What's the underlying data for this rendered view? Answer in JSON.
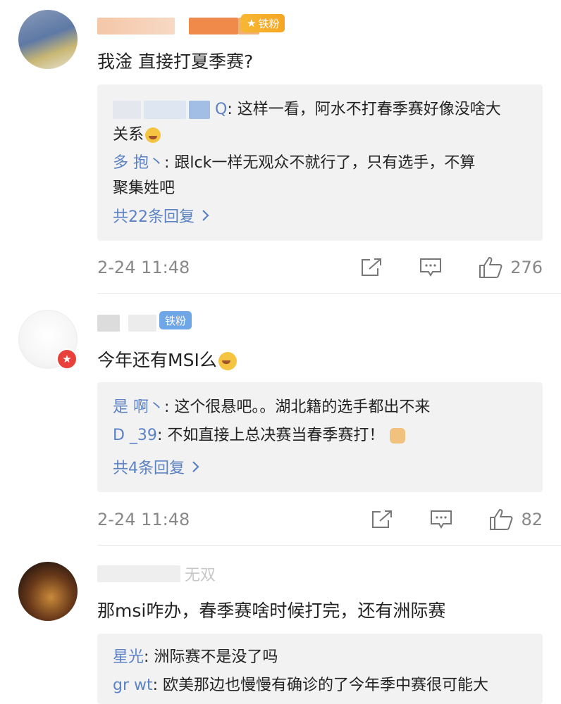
{
  "comments": [
    {
      "username": "",
      "badge": "铁粉",
      "badge_style": "gold",
      "text": "我淦 直接打夏季赛?",
      "replies": [
        {
          "name": "Q",
          "text": ": 这样一看，阿水不打春季赛好像没啥大",
          "text2": "关系"
        },
        {
          "name": "多 抱丶",
          "text": ": 跟lck一样无观众不就行了，只有选手，不算",
          "text2": "聚集姓吧"
        }
      ],
      "more_replies": "共22条回复",
      "timestamp": "2-24 11:48",
      "likes": "276"
    },
    {
      "username": "",
      "badge": "铁粉",
      "badge_style": "blue",
      "text": "今年还有MSI么",
      "replies": [
        {
          "name": "是 啊丶",
          "text": ": 这个很悬吧。。湖北籍的选手都出不来"
        },
        {
          "name": "D _39",
          "text": ": 不如直接上总决赛当春季赛打！"
        }
      ],
      "more_replies": "共4条回复",
      "timestamp": "2-24 11:48",
      "likes": "82"
    },
    {
      "username": "无双",
      "text": "那msi咋办，春季赛啥时候打完，还有洲际赛",
      "replies": [
        {
          "name": "星光",
          "text": ": 洲际赛不是没了吗"
        },
        {
          "name": "gr wt",
          "text": ": 欧美那边也慢慢有确诊的了今年季中赛很可能大"
        }
      ]
    }
  ],
  "icons": {
    "share": "share-icon",
    "comment": "comment-icon",
    "like": "thumbs-up-icon",
    "chevron": "chevron-right-icon"
  },
  "colors": {
    "link": "#5b82c4",
    "username": "#e06a2a",
    "meta": "#888888",
    "reply_bg": "#f2f2f2"
  }
}
